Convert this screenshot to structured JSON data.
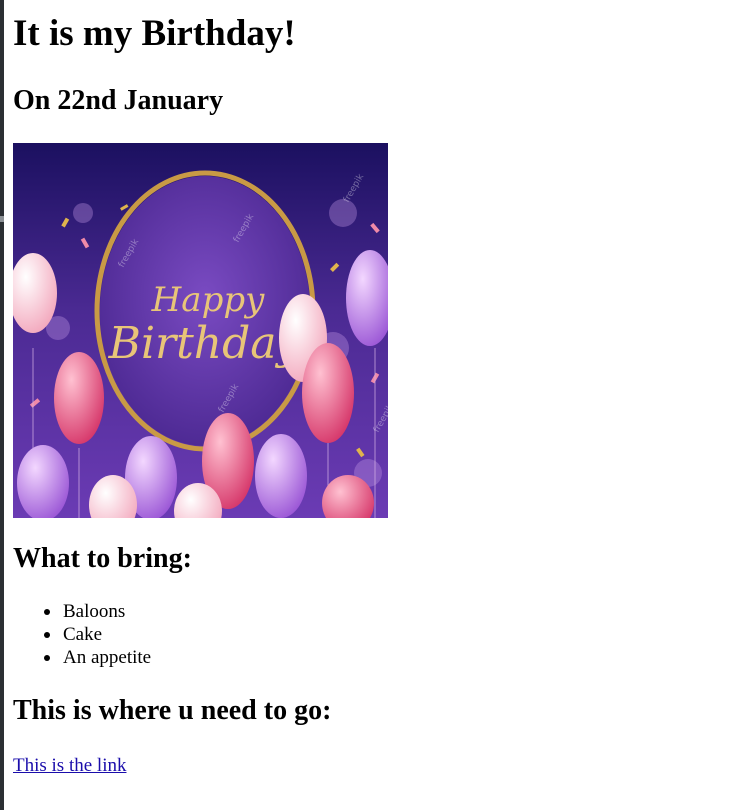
{
  "page": {
    "title": "It is my Birthday!",
    "date_heading": "On 22nd January",
    "image": {
      "text_line1": "Happy",
      "text_line2": "Birthday",
      "watermark": "freepik",
      "colors": {
        "background": "#5b2d9e",
        "frame": "#c9a24a",
        "balloon_pink": "#e8577f",
        "balloon_lilac": "#b57fe0",
        "balloon_white": "#fbe4ea"
      }
    },
    "bring_heading": "What to bring:",
    "bring_items": [
      "Baloons",
      "Cake",
      "An appetite"
    ],
    "go_heading": "This is where u need to go:",
    "link_text": "This is the link"
  }
}
